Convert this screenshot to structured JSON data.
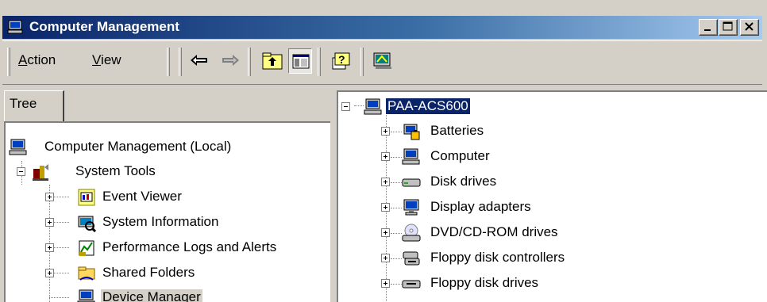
{
  "window": {
    "title": "Computer Management",
    "controls": [
      "minimize-icon",
      "maximize-icon",
      "close-icon"
    ]
  },
  "menu": {
    "action": {
      "mnemonic": "A",
      "rest": "ction"
    },
    "view": {
      "mnemonic": "V",
      "rest": "iew"
    }
  },
  "toolbar": {
    "buttons": [
      "back-arrow-icon",
      "forward-arrow-icon",
      "up-folder-icon",
      "show-hide-tree-icon",
      "help-icon",
      "device-manager-toolbar-icon"
    ]
  },
  "left_pane": {
    "tab_label": "Tree",
    "tree": [
      {
        "label": "Computer Management (Local)",
        "icon": "computer-icon"
      },
      {
        "label": "System Tools",
        "icon": "system-tools-icon",
        "expanded": true
      },
      {
        "label": "Event Viewer",
        "icon": "event-viewer-icon"
      },
      {
        "label": "System Information",
        "icon": "system-information-icon"
      },
      {
        "label": "Performance Logs and Alerts",
        "icon": "performance-logs-icon"
      },
      {
        "label": "Shared Folders",
        "icon": "shared-folders-icon"
      },
      {
        "label": "Device Manager",
        "icon": "device-manager-icon",
        "highlighted": true
      }
    ]
  },
  "right_pane": {
    "root": {
      "label": "PAA-ACS600",
      "icon": "computer-icon",
      "selected": true
    },
    "devices": [
      {
        "label": "Batteries",
        "icon": "batteries-icon"
      },
      {
        "label": "Computer",
        "icon": "computer-icon"
      },
      {
        "label": "Disk drives",
        "icon": "disk-drive-icon"
      },
      {
        "label": "Display adapters",
        "icon": "display-adapter-icon"
      },
      {
        "label": "DVD/CD-ROM drives",
        "icon": "cdrom-icon"
      },
      {
        "label": "Floppy disk controllers",
        "icon": "floppy-controller-icon"
      },
      {
        "label": "Floppy disk drives",
        "icon": "floppy-drive-icon"
      }
    ]
  },
  "colors": {
    "title_gradient_start": "#0a246a",
    "title_gradient_end": "#a6caf0",
    "face": "#d4d0c8",
    "selection": "#0a246a"
  }
}
